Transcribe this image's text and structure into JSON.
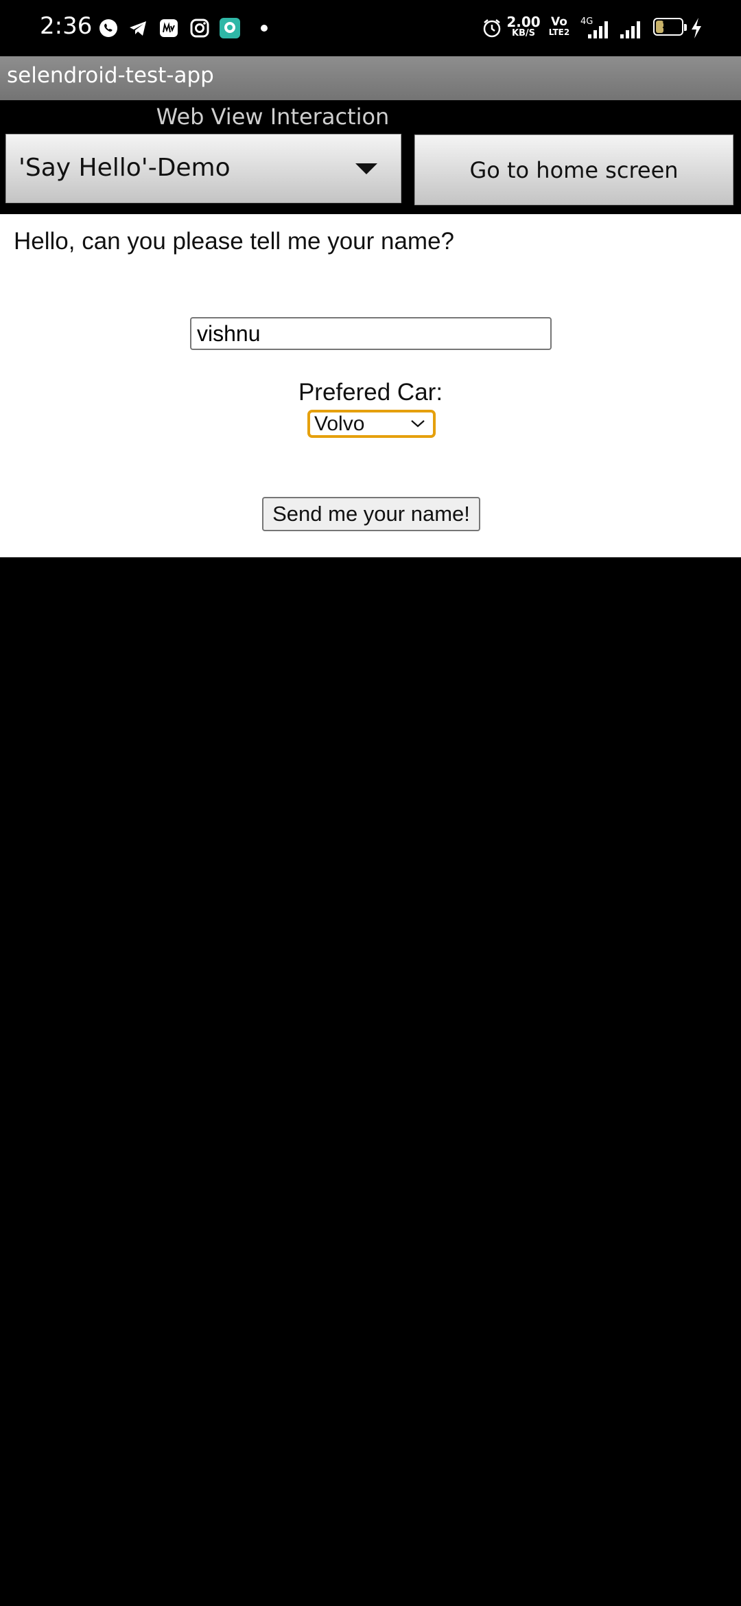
{
  "status_bar": {
    "time": "2:36",
    "net_speed_value": "2.00",
    "net_speed_unit": "KB/S",
    "volte_top": "Vo",
    "volte_bottom": "LTE2",
    "network_type": "4G",
    "battery_level": "37",
    "battery_fill_percent": 37,
    "notification_icons": [
      "whatsapp-icon",
      "telegram-icon",
      "myntra-icon",
      "instagram-icon",
      "chat-app-icon",
      "dot-icon"
    ],
    "system_icons": [
      "alarm-icon",
      "signal-icon",
      "signal-icon",
      "charging-bolt-icon"
    ]
  },
  "app_bar": {
    "title": "selendroid-test-app"
  },
  "activity": {
    "title": "Web View Interaction",
    "spinner_value": "'Say Hello'-Demo",
    "home_button_label": "Go to home screen"
  },
  "webview": {
    "question": "Hello, can you please tell me your name?",
    "name_value": "vishnu",
    "car_label": "Prefered Car:",
    "car_selected": "Volvo",
    "submit_label": "Send me your name!"
  },
  "colors": {
    "select_focus": "#e5a00d",
    "app_bar": "#808080"
  }
}
